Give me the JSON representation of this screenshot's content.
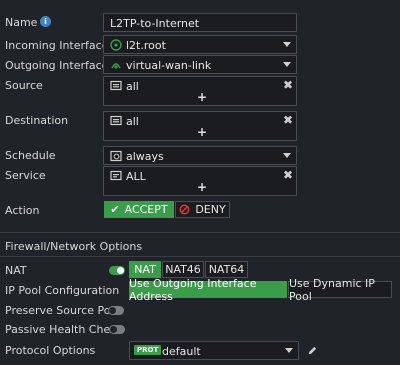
{
  "name": {
    "label": "Name",
    "value": "L2TP-to-Internet"
  },
  "incoming": {
    "label": "Incoming Interface",
    "value": "l2t.root"
  },
  "outgoing": {
    "label": "Outgoing Interface",
    "value": "virtual-wan-link"
  },
  "source": {
    "label": "Source",
    "value": "all",
    "add": "+"
  },
  "destination": {
    "label": "Destination",
    "value": "all",
    "add": "+"
  },
  "schedule": {
    "label": "Schedule",
    "value": "always"
  },
  "service": {
    "label": "Service",
    "value": "ALL",
    "add": "+"
  },
  "action": {
    "label": "Action",
    "accept": "ACCEPT",
    "deny": "DENY",
    "selected": "ACCEPT"
  },
  "section_title": "Firewall/Network Options",
  "nat": {
    "label": "NAT",
    "enabled": true,
    "options": [
      "NAT",
      "NAT46",
      "NAT64"
    ],
    "selected": "NAT"
  },
  "ip_pool": {
    "label": "IP Pool Configuration",
    "option_outgoing": "Use Outgoing Interface Address",
    "option_dynamic": "Use Dynamic IP Pool",
    "selected": "Use Outgoing Interface Address"
  },
  "preserve_port": {
    "label": "Preserve Source Port",
    "enabled": false
  },
  "passive_health": {
    "label": "Passive Health Check",
    "enabled": false
  },
  "protocol": {
    "label": "Protocol Options",
    "badge": "PROT",
    "value": "default"
  },
  "colors": {
    "accent": "#3a9d49",
    "bg": "#202328",
    "field_bg": "#1a1c1f",
    "deny_icon": "#e0393e"
  }
}
